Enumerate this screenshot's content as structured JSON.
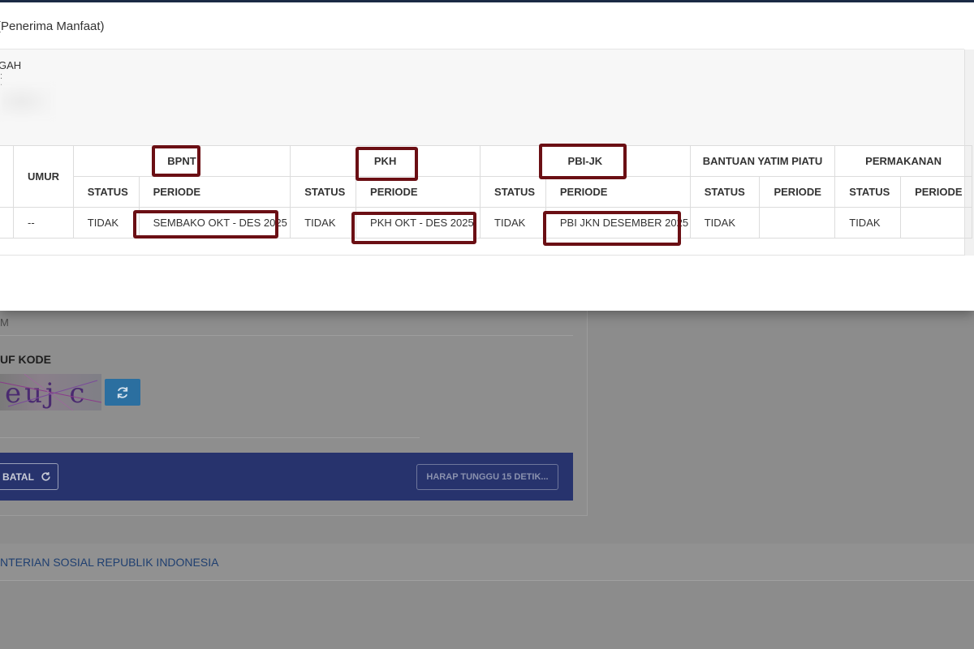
{
  "modal": {
    "title": "(Penerima Manfaat)",
    "info_text": "GAH",
    "info_dots": ":\n."
  },
  "table": {
    "umur_header": "UMUR",
    "groups": [
      {
        "name": "BPNT",
        "status": "TIDAK",
        "periode": "SEMBAKO OKT - DES 2025"
      },
      {
        "name": "PKH",
        "status": "TIDAK",
        "periode": "PKH OKT - DES 2025"
      },
      {
        "name": "PBI-JK",
        "status": "TIDAK",
        "periode": "PBI JKN DESEMBER 2025"
      },
      {
        "name": "BANTUAN YATIM PIATU",
        "status": "TIDAK",
        "periode": ""
      },
      {
        "name": "PERMAKANAN",
        "status": "TIDAK",
        "periode": ""
      }
    ],
    "status_header": "STATUS",
    "periode_header": "PERIODE",
    "umur_value": "--"
  },
  "background": {
    "small_text": "M",
    "code_label": "UF KODE",
    "captcha_text": "euj c",
    "batal_label": "BATAL",
    "wait_label": "HARAP TUNGGU 15 DETIK...",
    "footer_text": "NTERIAN SOSIAL REPUBLIK INDONESIA"
  },
  "colors": {
    "marker": "#6b0f14",
    "action_bar": "#27336d",
    "footer_link": "#1f3f70"
  },
  "icons": [
    "refresh-icon",
    "reset-icon"
  ]
}
